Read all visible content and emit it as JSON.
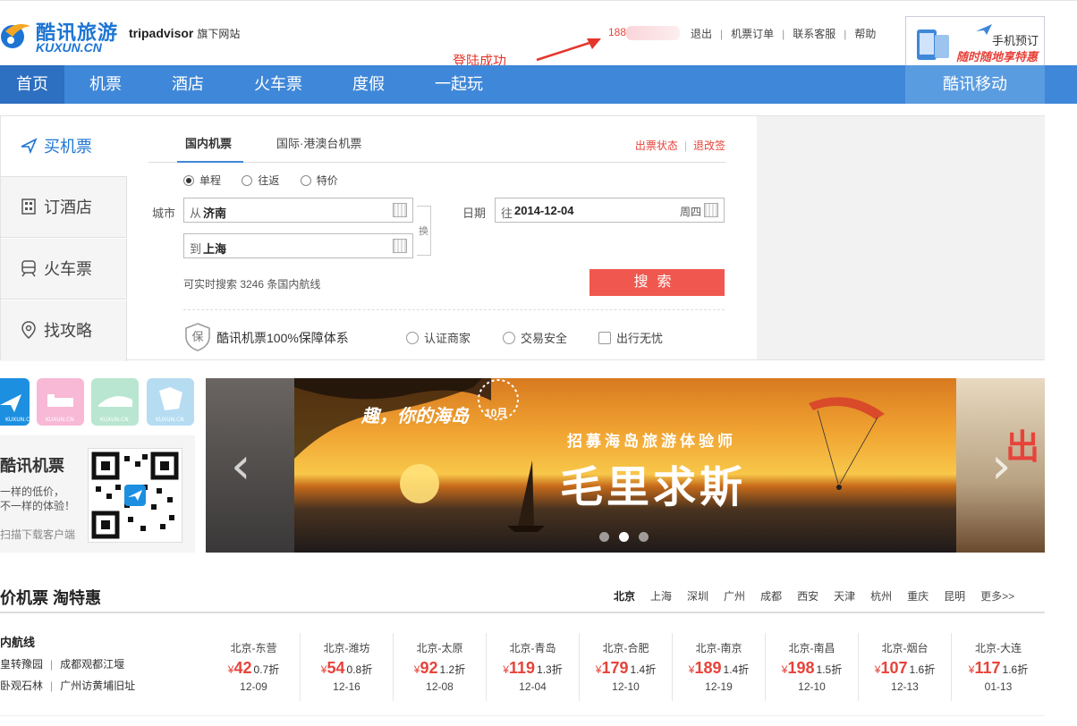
{
  "header": {
    "logo_cn": "酷讯旅游",
    "logo_en": "KUXUN.CN",
    "partner_brand": "tripadvisor",
    "partner_suffix": "旗下网站",
    "user_phone": "188",
    "links": [
      "退出",
      "机票订单",
      "联系客服",
      "帮助"
    ],
    "annotation": "登陆成功",
    "mobile_promo_title": "手机预订",
    "mobile_promo_sub": "随时随地享特惠"
  },
  "nav": {
    "items": [
      "首页",
      "机票",
      "酒店",
      "火车票",
      "度假",
      "一起玩"
    ],
    "active_index": 0,
    "right": "酷讯移动"
  },
  "search": {
    "side_tabs": [
      "买机票",
      "订酒店",
      "火车票",
      "找攻略"
    ],
    "tabs": [
      "国内机票",
      "国际·港澳台机票"
    ],
    "status_links": [
      "出票状态",
      "退改签"
    ],
    "trip_types": [
      "单程",
      "往返",
      "特价"
    ],
    "selected_trip_type": "单程",
    "city_label": "城市",
    "from_prefix": "从",
    "from_city": "济南",
    "to_prefix": "到",
    "to_city": "上海",
    "swap_label": "换",
    "date_label": "日期",
    "date_prefix": "往",
    "date_value": "2014-12-04",
    "weekday": "周四",
    "hint": "可实时搜索 3246 条国内航线",
    "search_button": "搜索",
    "guarantee_badge": "保",
    "guarantee": "酷讯机票100%保障体系",
    "features": [
      "认证商家",
      "交易安全",
      "出行无忧"
    ]
  },
  "apps": {
    "icon_label": "KUXUN.CN",
    "title": "酷讯机票",
    "lines": [
      "一样的低价，",
      "不一样的体验！",
      "扫描下载客户端"
    ]
  },
  "banner": {
    "tag": "趣，你的海岛",
    "month": "10月",
    "subtitle": "招募海岛旅游体验师",
    "title": "毛里求斯",
    "right_peek": "出"
  },
  "deals": {
    "section_title": "价机票 淘特惠",
    "cities": [
      "北京",
      "上海",
      "深圳",
      "广州",
      "成都",
      "西安",
      "天津",
      "杭州",
      "重庆",
      "昆明"
    ],
    "more": "更多>>",
    "domestic_title": "内航线",
    "route_row1": [
      "皇转豫园",
      "成都观都江堰"
    ],
    "route_row2": [
      "卧观石林",
      "广州访黄埔旧址"
    ],
    "fares": [
      {
        "route": "北京-东营",
        "price": "42",
        "discount": "0.7折",
        "date": "12-09"
      },
      {
        "route": "北京-潍坊",
        "price": "54",
        "discount": "0.8折",
        "date": "12-16"
      },
      {
        "route": "北京-太原",
        "price": "92",
        "discount": "1.2折",
        "date": "12-08"
      },
      {
        "route": "北京-青岛",
        "price": "119",
        "discount": "1.3折",
        "date": "12-04"
      },
      {
        "route": "北京-合肥",
        "price": "179",
        "discount": "1.4折",
        "date": "12-10"
      },
      {
        "route": "北京-南京",
        "price": "189",
        "discount": "1.4折",
        "date": "12-19"
      },
      {
        "route": "北京-南昌",
        "price": "198",
        "discount": "1.5折",
        "date": "12-10"
      },
      {
        "route": "北京-烟台",
        "price": "107",
        "discount": "1.6折",
        "date": "12-13"
      },
      {
        "route": "北京-大连",
        "price": "117",
        "discount": "1.6折",
        "date": "01-13"
      }
    ],
    "currency": "¥"
  },
  "colors": {
    "brand_blue": "#3f87d8",
    "accent_red": "#f0584f"
  }
}
